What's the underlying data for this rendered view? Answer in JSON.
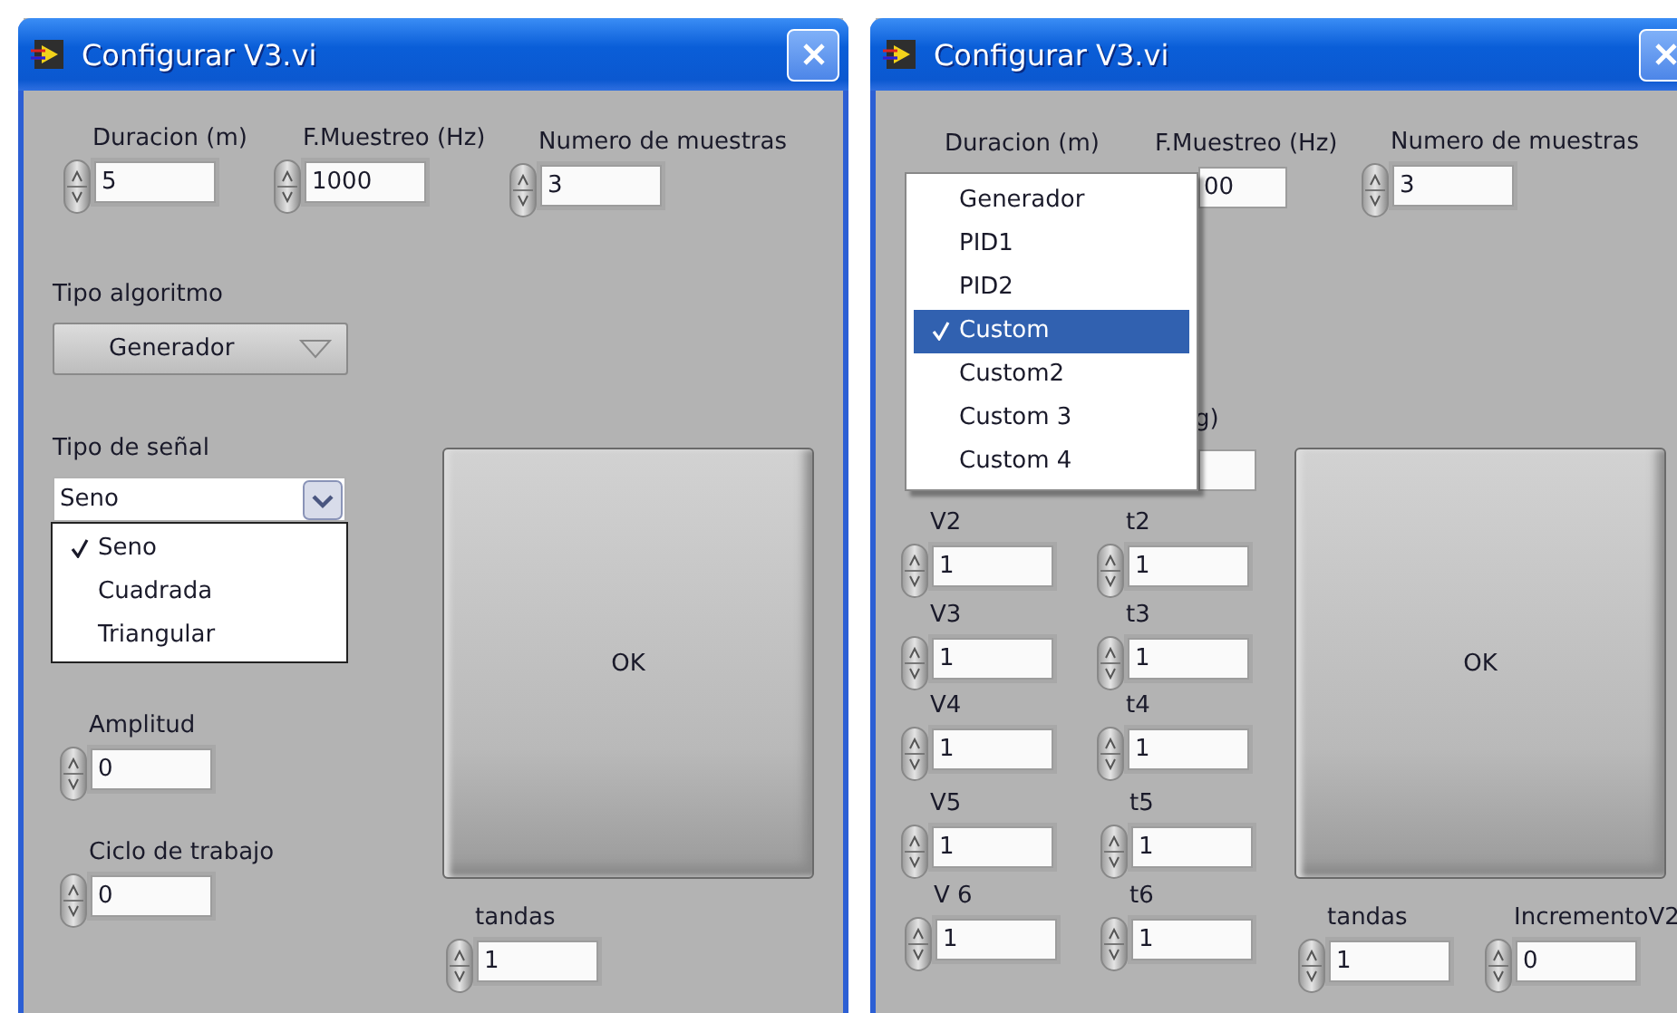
{
  "windows": [
    {
      "title": "Configurar V3.vi",
      "controls": [
        {
          "kind": "numeric",
          "label": "Duracion (m)",
          "value": "5"
        },
        {
          "kind": "numeric",
          "label": "F.Muestreo (Hz)",
          "value": "1000"
        },
        {
          "kind": "numeric",
          "label": "Numero de muestras",
          "value": "3"
        },
        {
          "kind": "ring",
          "label": "Tipo algoritmo",
          "value": "Generador"
        },
        {
          "kind": "combo",
          "label": "Tipo de señal",
          "value": "Seno",
          "options": [
            {
              "label": "Seno",
              "selected": true
            },
            {
              "label": "Cuadrada",
              "selected": false
            },
            {
              "label": "Triangular",
              "selected": false
            }
          ]
        },
        {
          "kind": "button",
          "label": "OK"
        },
        {
          "kind": "numeric",
          "label": "Amplitud",
          "value": "0"
        },
        {
          "kind": "numeric",
          "label": "Ciclo de trabajo",
          "value": "0"
        },
        {
          "kind": "numeric",
          "label": "tandas",
          "value": "1"
        }
      ]
    },
    {
      "title": "Configurar V3.vi",
      "controls": [
        {
          "kind": "label",
          "label": "Duracion (m)"
        },
        {
          "kind": "partial",
          "label": "F.Muestreo (Hz)",
          "value": "00"
        },
        {
          "kind": "numeric",
          "label": "Numero de muestras",
          "value": "3"
        },
        {
          "kind": "partial",
          "label": "g)"
        },
        {
          "kind": "numeric",
          "label": "V2",
          "value": "1"
        },
        {
          "kind": "numeric",
          "label": "t2",
          "value": "1"
        },
        {
          "kind": "numeric",
          "label": "V3",
          "value": "1"
        },
        {
          "kind": "numeric",
          "label": "t3",
          "value": "1"
        },
        {
          "kind": "numeric",
          "label": "V4",
          "value": "1"
        },
        {
          "kind": "numeric",
          "label": "t4",
          "value": "1"
        },
        {
          "kind": "numeric",
          "label": "V5",
          "value": "1"
        },
        {
          "kind": "numeric",
          "label": "t5",
          "value": "1"
        },
        {
          "kind": "numeric",
          "label": "V 6",
          "value": "1"
        },
        {
          "kind": "numeric",
          "label": "t6",
          "value": "1"
        },
        {
          "kind": "button",
          "label": "OK"
        },
        {
          "kind": "numeric",
          "label": "tandas",
          "value": "1"
        },
        {
          "kind": "numeric",
          "label": "IncrementoV2",
          "value": "0"
        },
        {
          "kind": "menu",
          "options": [
            {
              "label": "Generador",
              "selected": false
            },
            {
              "label": "PID1",
              "selected": false
            },
            {
              "label": "PID2",
              "selected": false
            },
            {
              "label": "Custom",
              "selected": true
            },
            {
              "label": "Custom2",
              "selected": false
            },
            {
              "label": "Custom 3",
              "selected": false
            },
            {
              "label": "Custom 4",
              "selected": false
            }
          ]
        }
      ]
    }
  ]
}
